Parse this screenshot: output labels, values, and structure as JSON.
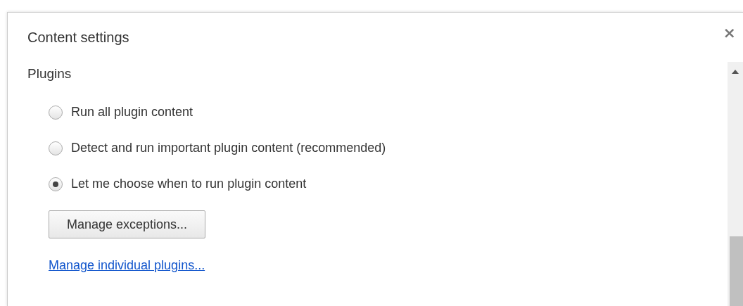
{
  "dialog": {
    "title": "Content settings",
    "close": "×"
  },
  "section": {
    "heading": "Plugins",
    "options": [
      {
        "label": "Run all plugin content",
        "selected": false
      },
      {
        "label": "Detect and run important plugin content (recommended)",
        "selected": false
      },
      {
        "label": "Let me choose when to run plugin content",
        "selected": true
      }
    ],
    "button": "Manage exceptions...",
    "link": "Manage individual plugins..."
  }
}
